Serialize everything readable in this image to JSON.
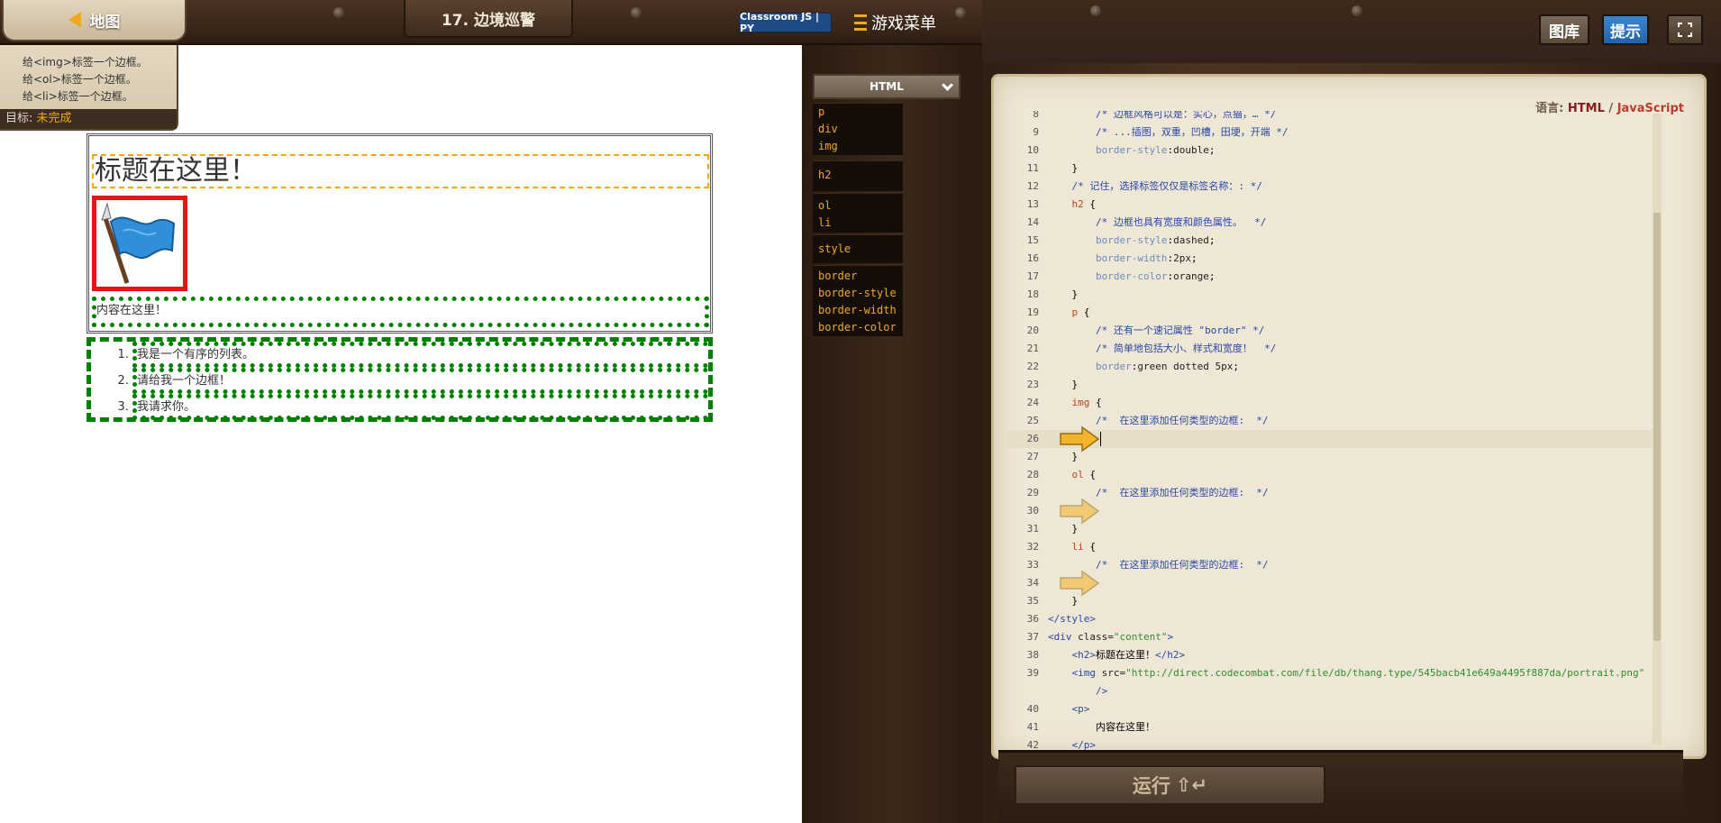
{
  "topbar": {
    "map_label": "地图",
    "level_title": "17. 边境巡警",
    "classroom_badge": "Classroom JS | PY",
    "game_menu_label": "游戏菜单"
  },
  "goals": {
    "items": [
      "给<img>标签一个边框。",
      "给<ol>标签一个边框。",
      "给<li>标签一个边框。"
    ],
    "status_label": "目标:",
    "status_value": "未完成"
  },
  "preview": {
    "heading": "标题在这里！",
    "paragraph": "内容在这里！",
    "list_items": [
      "我是一个有序的列表。",
      "请给我一个边框！",
      "我请求你。"
    ]
  },
  "palette": {
    "header": "HTML",
    "groups": [
      [
        "p",
        "div",
        "img"
      ],
      [
        "h2"
      ],
      [
        "ol",
        "li"
      ],
      [
        "style"
      ],
      [
        "border",
        "border-style",
        "border-width",
        "border-color"
      ]
    ]
  },
  "right_buttons": {
    "library": "图库",
    "hint": "提示"
  },
  "editor": {
    "language_prefix": "语言:",
    "language_html": "HTML",
    "language_sep": "/",
    "language_js": "JavaScript",
    "lines": [
      {
        "n": "8",
        "html": "        <span class='c-comment'>/* 边框风格可以是：实心，点猫，… */</span>"
      },
      {
        "n": "9",
        "html": "        <span class='c-comment'>/* ...插图，双重，凹槽，田埂，开端 */</span>"
      },
      {
        "n": "10",
        "html": "        <span class='c-prop'>border-style</span>:<span class='c-val'>double</span>;"
      },
      {
        "n": "11",
        "html": "    }"
      },
      {
        "n": "12",
        "html": "    <span class='c-comment'>/* 记住，选择标签仅仅是标签名称：: */</span>"
      },
      {
        "n": "13",
        "html": "    <span class='c-sel'>h2</span> {"
      },
      {
        "n": "14",
        "html": "        <span class='c-comment'>/* 边框也具有宽度和颜色属性。  */</span>"
      },
      {
        "n": "15",
        "html": "        <span class='c-prop'>border-style</span>:<span class='c-val'>dashed</span>;"
      },
      {
        "n": "16",
        "html": "        <span class='c-prop'>border-width</span>:<span class='c-val'>2px</span>;"
      },
      {
        "n": "17",
        "html": "        <span class='c-prop'>border-color</span>:<span class='c-val'>orange</span>;"
      },
      {
        "n": "18",
        "html": "    }"
      },
      {
        "n": "19",
        "html": "    <span class='c-sel'>p</span> {"
      },
      {
        "n": "20",
        "html": "        <span class='c-comment'>/* 还有一个速记属性 \"border\" */</span>"
      },
      {
        "n": "21",
        "html": "        <span class='c-comment'>/* 简单地包括大小、样式和宽度！  */</span>"
      },
      {
        "n": "22",
        "html": "        <span class='c-prop'>border</span>:<span class='c-val'>green dotted 5px</span>;"
      },
      {
        "n": "23",
        "html": "    }"
      },
      {
        "n": "24",
        "html": "    <span class='c-sel'>img</span> {"
      },
      {
        "n": "25",
        "html": "        <span class='c-comment'>/*  在这里添加任何类型的边框:  */</span>"
      },
      {
        "n": "26",
        "html": ""
      },
      {
        "n": "27",
        "html": "    }"
      },
      {
        "n": "28",
        "html": "    <span class='c-sel'>ol</span> {"
      },
      {
        "n": "29",
        "html": "        <span class='c-comment'>/*  在这里添加任何类型的边框:  */</span>"
      },
      {
        "n": "30",
        "html": ""
      },
      {
        "n": "31",
        "html": "    }"
      },
      {
        "n": "32",
        "html": "    <span class='c-sel'>li</span> {"
      },
      {
        "n": "33",
        "html": "        <span class='c-comment'>/*  在这里添加任何类型的边框:  */</span>"
      },
      {
        "n": "34",
        "html": ""
      },
      {
        "n": "35",
        "html": "    }"
      },
      {
        "n": "36",
        "html": "<span class='c-tag'>&lt;/style&gt;</span>"
      },
      {
        "n": "37",
        "html": "<span class='c-tag'>&lt;div</span> <span class='c-val'>class=</span><span class='c-str'>\"content\"</span><span class='c-tag'>&gt;</span>"
      },
      {
        "n": "38",
        "html": "    <span class='c-tag'>&lt;h2&gt;</span>标题在这里！<span class='c-tag'>&lt;/h2&gt;</span>"
      },
      {
        "n": "39",
        "html": "    <span class='c-tag'>&lt;img</span> <span class='c-val'>src=</span><span class='c-str'>\"http://direct.codecombat.com/file/db/thang.type/545bacb41e649a4495f887da/portrait.png\"</span>"
      },
      {
        "n": "",
        "html": "        <span class='c-tag'>/&gt;</span>"
      },
      {
        "n": "40",
        "html": "    <span class='c-tag'>&lt;p&gt;</span>"
      },
      {
        "n": "41",
        "html": "        内容在这里！"
      },
      {
        "n": "42",
        "html": "    <span class='c-tag'>&lt;/p&gt;</span>"
      }
    ]
  },
  "run_button": {
    "label": "运行",
    "shortcut": "⇧↵"
  }
}
